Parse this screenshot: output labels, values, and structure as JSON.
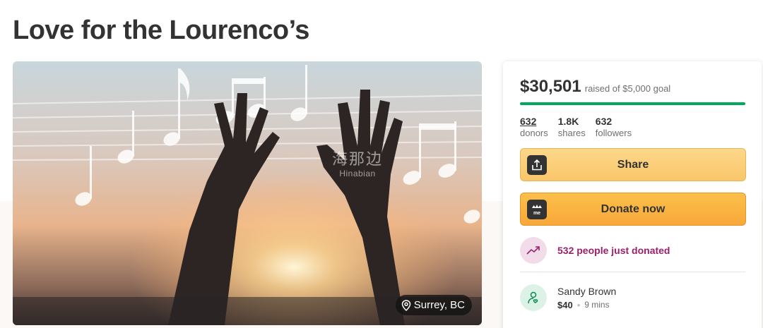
{
  "page": {
    "title": "Love for the Lourenco’s"
  },
  "hero": {
    "location": "Surrey, BC",
    "watermark": "海那边",
    "watermark_sub": "Hinabian"
  },
  "campaign": {
    "raised_amount": "$30,501",
    "goal_text": "raised of $5,000 goal",
    "progress_fraction": 1.0,
    "stats": [
      {
        "value": "632",
        "label": "donors"
      },
      {
        "value": "1.8K",
        "label": "shares"
      },
      {
        "value": "632",
        "label": "followers"
      }
    ],
    "share_label": "Share",
    "donate_label": "Donate now",
    "recent_activity": "532 people just donated",
    "latest_donor": {
      "name": "Sandy Brown",
      "amount": "$40",
      "time": "9 mins"
    }
  },
  "colors": {
    "progress": "#02a95c",
    "activity_text": "#9b1f6a",
    "share_button": "#f9c66a",
    "donate_button": "#f8a83a"
  },
  "icons": [
    "map-pin-icon",
    "share-upload-icon",
    "gofundme-logo-icon",
    "trending-up-icon",
    "heart-hand-user-icon"
  ]
}
